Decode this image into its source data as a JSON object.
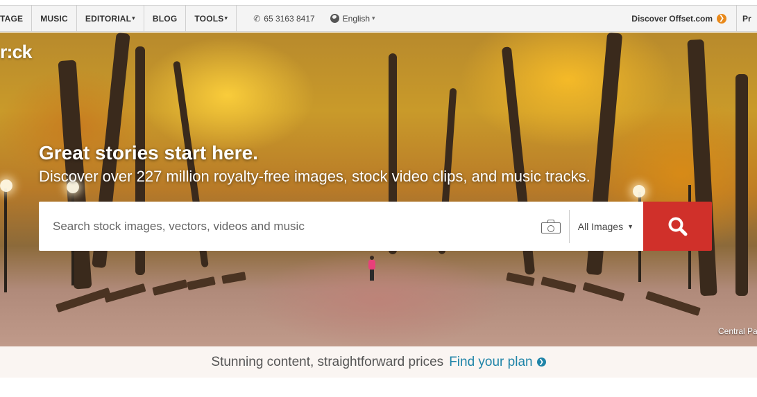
{
  "nav": {
    "items": [
      {
        "label": "TAGE",
        "caret": ""
      },
      {
        "label": "MUSIC",
        "caret": ""
      },
      {
        "label": "EDITORIAL",
        "caret": "▾"
      },
      {
        "label": "BLOG",
        "caret": ""
      },
      {
        "label": "TOOLS",
        "caret": "▾"
      }
    ],
    "phone": "65 3163 8417",
    "language": "English",
    "language_caret": "▾",
    "discover": "Discover Offset.com",
    "right_cut": "Pr"
  },
  "hero": {
    "logo": "r:ck",
    "headline": "Great stories start here.",
    "subline": "Discover over 227 million royalty-free images, stock video clips, and music tracks.",
    "credit": "Central Pa"
  },
  "search": {
    "placeholder": "Search stock images, vectors, videos and music",
    "value": "",
    "filter": "All Images",
    "accent": "#d0302a"
  },
  "promo": {
    "text": "Stunning content, straightforward prices",
    "link": "Find your plan",
    "link_color": "#1f84a8"
  },
  "icons": [
    "phone-icon",
    "globe-icon",
    "arrow-right-circle-icon",
    "camera-icon",
    "search-icon",
    "caret-down-icon"
  ]
}
